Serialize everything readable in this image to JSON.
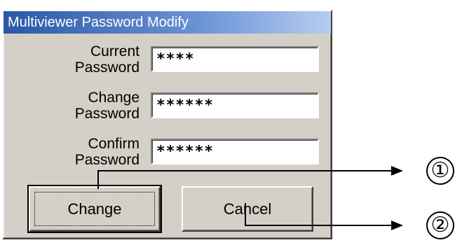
{
  "dialog": {
    "title": "Multiviewer Password Modify",
    "fields": [
      {
        "label_line1": "Current",
        "label_line2": "Password",
        "value": "****"
      },
      {
        "label_line1": "Change",
        "label_line2": "Password",
        "value": "******"
      },
      {
        "label_line1": "Confirm",
        "label_line2": "Password",
        "value": "******"
      }
    ],
    "buttons": {
      "change": "Change",
      "cancel": "Cancel"
    }
  },
  "callouts": {
    "one": "①",
    "two": "②"
  }
}
